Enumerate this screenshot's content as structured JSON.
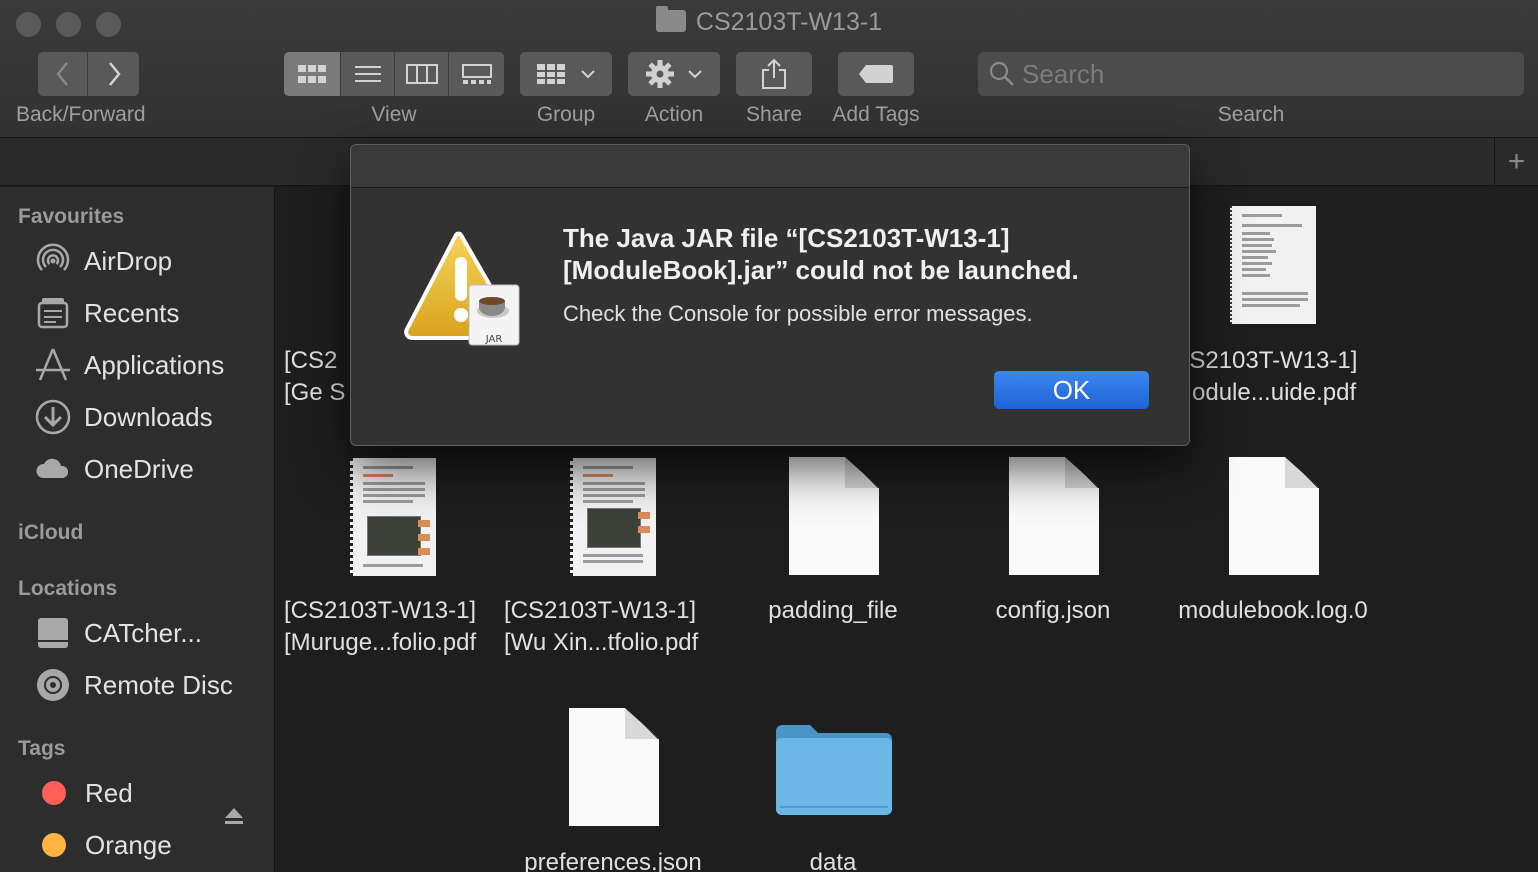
{
  "window": {
    "title": "CS2103T-W13-1"
  },
  "toolbar": {
    "back_forward_label": "Back/Forward",
    "view_label": "View",
    "group_label": "Group",
    "action_label": "Action",
    "share_label": "Share",
    "add_tags_label": "Add Tags",
    "search_label": "Search",
    "search_placeholder": "Search"
  },
  "sidebar": {
    "favourites_header": "Favourites",
    "favourites": [
      {
        "label": "AirDrop",
        "icon": "airdrop-icon"
      },
      {
        "label": "Recents",
        "icon": "recents-icon"
      },
      {
        "label": "Applications",
        "icon": "applications-icon"
      },
      {
        "label": "Downloads",
        "icon": "downloads-icon"
      },
      {
        "label": "OneDrive",
        "icon": "cloud-icon"
      }
    ],
    "icloud_header": "iCloud",
    "locations_header": "Locations",
    "locations": [
      {
        "label": "CATcher...",
        "icon": "disk-icon"
      },
      {
        "label": "Remote Disc",
        "icon": "disc-icon"
      }
    ],
    "tags_header": "Tags",
    "tags": [
      {
        "label": "Red",
        "color": "#ff5f57"
      },
      {
        "label": "Orange",
        "color": "#ffb340"
      }
    ]
  },
  "files": [
    {
      "name": "[CS2\n[Ge S",
      "kind": "pdf-partial"
    },
    {
      "name": "CS2103T-W13-1]\nModule...uide.pdf",
      "kind": "pdf"
    },
    {
      "name": "[CS2103T-W13-1]\n[Muruge...folio.pdf",
      "kind": "pdf"
    },
    {
      "name": "[CS2103T-W13-1]\n[Wu Xin...tfolio.pdf",
      "kind": "pdf"
    },
    {
      "name": "padding_file",
      "kind": "blank"
    },
    {
      "name": "config.json",
      "kind": "blank"
    },
    {
      "name": "modulebook.log.0",
      "kind": "blank"
    },
    {
      "name": "preferences.json",
      "kind": "blank"
    },
    {
      "name": "data",
      "kind": "folder"
    }
  ],
  "dialog": {
    "title": "The Java JAR file “[CS2103T-W13-1] [ModuleBook].jar” could not be launched.",
    "message": "Check the Console for possible error messages.",
    "ok_label": "OK",
    "icon": "warning-jar-icon",
    "badge_text": "JAR"
  },
  "colors": {
    "accent": "#2a6fe0",
    "folder": "#6cb7e6"
  }
}
